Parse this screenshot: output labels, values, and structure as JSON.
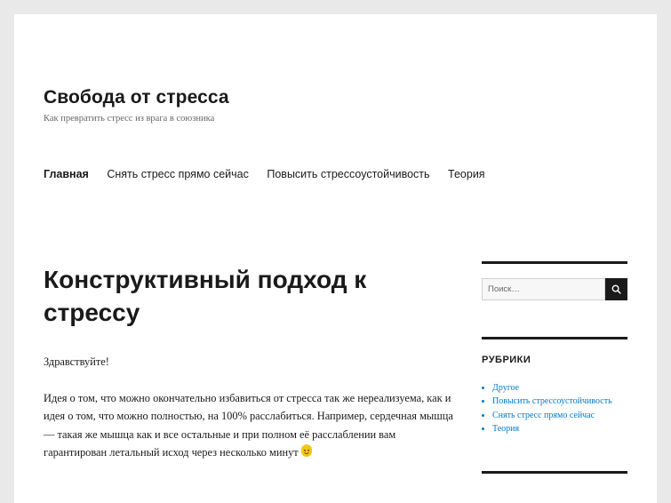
{
  "site": {
    "title": "Свобода от стресса",
    "description": "Как превратить стресс из врага в союзника"
  },
  "nav": {
    "items": [
      {
        "label": "Главная",
        "current": true
      },
      {
        "label": "Снять стресс прямо сейчас",
        "current": false
      },
      {
        "label": "Повысить стрессоустойчивость",
        "current": false
      },
      {
        "label": "Теория",
        "current": false
      }
    ]
  },
  "post": {
    "title": "Конструктивный подход к стрессу",
    "paragraphs": [
      "Здравствуйте!",
      "Идея о том, что можно окончательно избавиться от стресса так же нереализуема, как и идея о том, что можно полностью, на 100% расслабиться. Например, сердечная мышца — такая же мышца как и все остальные и при полном её расслаблении вам гарантирован летальный исход через несколько минут"
    ],
    "emoji": "slightly-smiling-face-icon"
  },
  "sidebar": {
    "search": {
      "placeholder": "Поиск…",
      "value": "",
      "icon": "search-icon"
    },
    "categories": {
      "title": "РУБРИКИ",
      "items": [
        {
          "label": "Другое"
        },
        {
          "label": "Повысить стрессоустойчивость"
        },
        {
          "label": "Снять стресс прямо сейчас"
        },
        {
          "label": "Теория"
        }
      ]
    }
  },
  "colors": {
    "link": "#007acc",
    "text": "#1a1a1a",
    "muted": "#686868",
    "background": "#e9e9e9"
  }
}
